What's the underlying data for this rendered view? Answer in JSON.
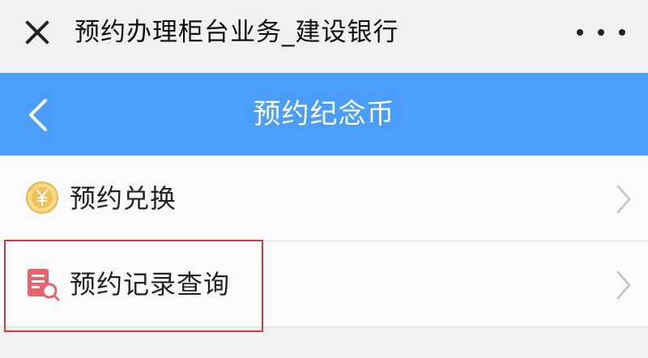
{
  "window": {
    "title": "预约办理柜台业务_建设银行",
    "close_icon": "close-icon",
    "more_icon": "more-dots-icon"
  },
  "navbar": {
    "title": "预约纪念币",
    "back_icon": "chevron-left-icon",
    "background": "#4a9df8"
  },
  "menu": {
    "items": [
      {
        "label": "预约兑换",
        "icon": "coin-exchange-icon"
      },
      {
        "label": "预约记录查询",
        "icon": "record-search-icon"
      }
    ]
  },
  "colors": {
    "accent": "#4a9df8",
    "highlight": "#d9363e",
    "coin": "#f0c25a",
    "record_icon": "#e8636b"
  }
}
